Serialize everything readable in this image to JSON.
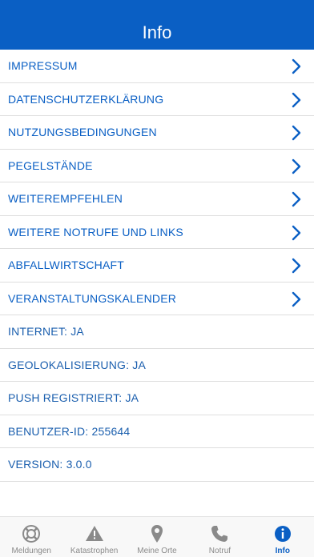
{
  "header": {
    "title": "Info"
  },
  "colors": {
    "brand": "#0a5fc4",
    "inactive": "#8a8a8a"
  },
  "menu": [
    {
      "label": "IMPRESSUM",
      "has_chevron": true
    },
    {
      "label": "DATENSCHUTZERKLÄRUNG",
      "has_chevron": true
    },
    {
      "label": "NUTZUNGSBEDINGUNGEN",
      "has_chevron": true
    },
    {
      "label": "PEGELSTÄNDE",
      "has_chevron": true
    },
    {
      "label": "WEITEREMPFEHLEN",
      "has_chevron": true
    },
    {
      "label": "WEITERE NOTRUFE UND LINKS",
      "has_chevron": true
    },
    {
      "label": "ABFALLWIRTSCHAFT",
      "has_chevron": true
    },
    {
      "label": "VERANSTALTUNGSKALENDER",
      "has_chevron": true
    }
  ],
  "status": [
    {
      "label": "INTERNET: JA"
    },
    {
      "label": "GEOLOKALISIERUNG: JA"
    },
    {
      "label": "PUSH REGISTRIERT: JA"
    },
    {
      "label": "BENUTZER-ID: 255644"
    },
    {
      "label": "VERSION: 3.0.0"
    }
  ],
  "tabbar": {
    "tabs": [
      {
        "label": "Meldungen",
        "icon": "lifebuoy-icon",
        "active": false
      },
      {
        "label": "Katastrophen",
        "icon": "warning-icon",
        "active": false
      },
      {
        "label": "Meine Orte",
        "icon": "location-pin-icon",
        "active": false
      },
      {
        "label": "Notruf",
        "icon": "phone-icon",
        "active": false
      },
      {
        "label": "Info",
        "icon": "info-icon",
        "active": true
      }
    ]
  }
}
